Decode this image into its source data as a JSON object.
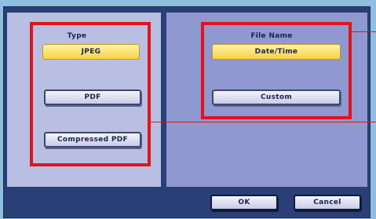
{
  "type_section": {
    "label": "Type",
    "options": [
      "JPEG",
      "PDF",
      "Compressed PDF"
    ],
    "selected": "JPEG"
  },
  "file_name_section": {
    "label": "File Name",
    "options": [
      "Date/Time",
      "Custom"
    ],
    "selected": "Date/Time"
  },
  "footer": {
    "ok_label": "OK",
    "cancel_label": "Cancel"
  },
  "colors": {
    "highlight": "#e0141b",
    "selected_button": "#f6d24d",
    "panel_left": "#b9bfe2",
    "panel_right": "#8f98cf",
    "frame": "#2a3f75"
  }
}
